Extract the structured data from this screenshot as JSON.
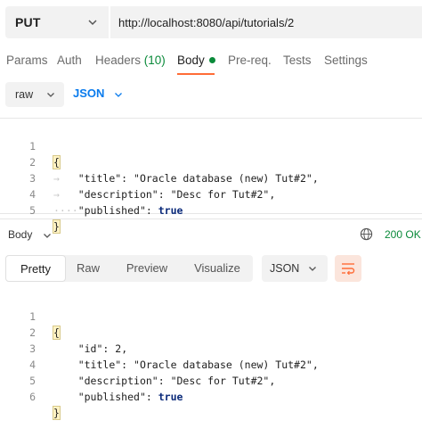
{
  "request": {
    "method": "PUT",
    "url": "http://localhost:8080/api/tutorials/2"
  },
  "request_tabs": {
    "params": "Params",
    "auth": "Auth",
    "headers": "Headers",
    "headers_count": "(10)",
    "body": "Body",
    "prereq": "Pre-req.",
    "tests": "Tests",
    "settings": "Settings",
    "active": "Body"
  },
  "body_mode": {
    "type": "raw",
    "language": "JSON"
  },
  "request_body": {
    "line_numbers": [
      "1",
      "2",
      "3",
      "4",
      "5"
    ],
    "open_brace": "{",
    "close_brace": "}",
    "title_key": "\"title\"",
    "title_value": "\"Oracle database (new) Tut#2\"",
    "description_key": "\"description\"",
    "description_value": "\"Desc for Tut#2\"",
    "published_key": "\"published\"",
    "published_value": "true"
  },
  "response": {
    "section_label": "Body",
    "status": "200 OK",
    "view_tabs": [
      "Pretty",
      "Raw",
      "Preview",
      "Visualize"
    ],
    "active_view": "Pretty",
    "format": "JSON"
  },
  "response_body": {
    "line_numbers": [
      "1",
      "2",
      "3",
      "4",
      "5",
      "6"
    ],
    "open_brace": "{",
    "close_brace": "}",
    "id_key": "\"id\"",
    "id_value": "2",
    "title_key": "\"title\"",
    "title_value": "\"Oracle database (new) Tut#2\"",
    "description_key": "\"description\"",
    "description_value": "\"Desc for Tut#2\"",
    "published_key": "\"published\"",
    "published_value": "true"
  },
  "colors": {
    "accent": "#ff6c37",
    "success": "#0a8a3a",
    "link": "#097bed",
    "panel": "#f2f2f2"
  },
  "icons": [
    "chevron-down-icon",
    "globe-icon",
    "wrap-lines-icon",
    "dot-indicator-icon"
  ]
}
